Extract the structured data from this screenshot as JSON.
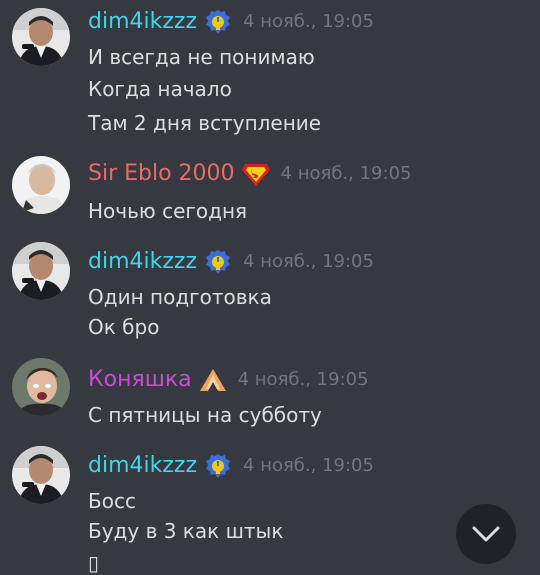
{
  "messages": [
    {
      "username": "dim4ikzzz",
      "username_color": "#3fd5ea",
      "timestamp": "4 нояб., 19:05",
      "badge": "moderator-badge-icon",
      "lines": [
        "И всегда не понимаю",
        "Когда начало",
        "Там 2 дня вступление"
      ]
    },
    {
      "username": "Sir Eblo 2000",
      "username_color": "#e96a6a",
      "timestamp": "4 нояб., 19:05",
      "badge": "superman-badge-icon",
      "lines": [
        "Ночью сегодня"
      ]
    },
    {
      "username": "dim4ikzzz",
      "username_color": "#3fd5ea",
      "timestamp": "4 нояб., 19:05",
      "badge": "moderator-badge-icon",
      "lines": [
        "Один подготовка",
        "Ок бро"
      ]
    },
    {
      "username": "Коняшка",
      "username_color": "#c84dd6",
      "timestamp": "4 нояб., 19:05",
      "badge": "apex-badge-icon",
      "lines": [
        "С пятницы на субботу"
      ]
    },
    {
      "username": "dim4ikzzz",
      "username_color": "#3fd5ea",
      "timestamp": "4 нояб., 19:05",
      "badge": "moderator-badge-icon",
      "lines": [
        "Босс",
        "Буду в 3 как штык",
        "▯"
      ]
    }
  ],
  "scroll_button": {
    "icon": "chevron-down-icon"
  },
  "colors": {
    "background": "#36393f",
    "text": "#dcddde",
    "timestamp": "#72767d",
    "scroll_button_bg": "#202225"
  }
}
